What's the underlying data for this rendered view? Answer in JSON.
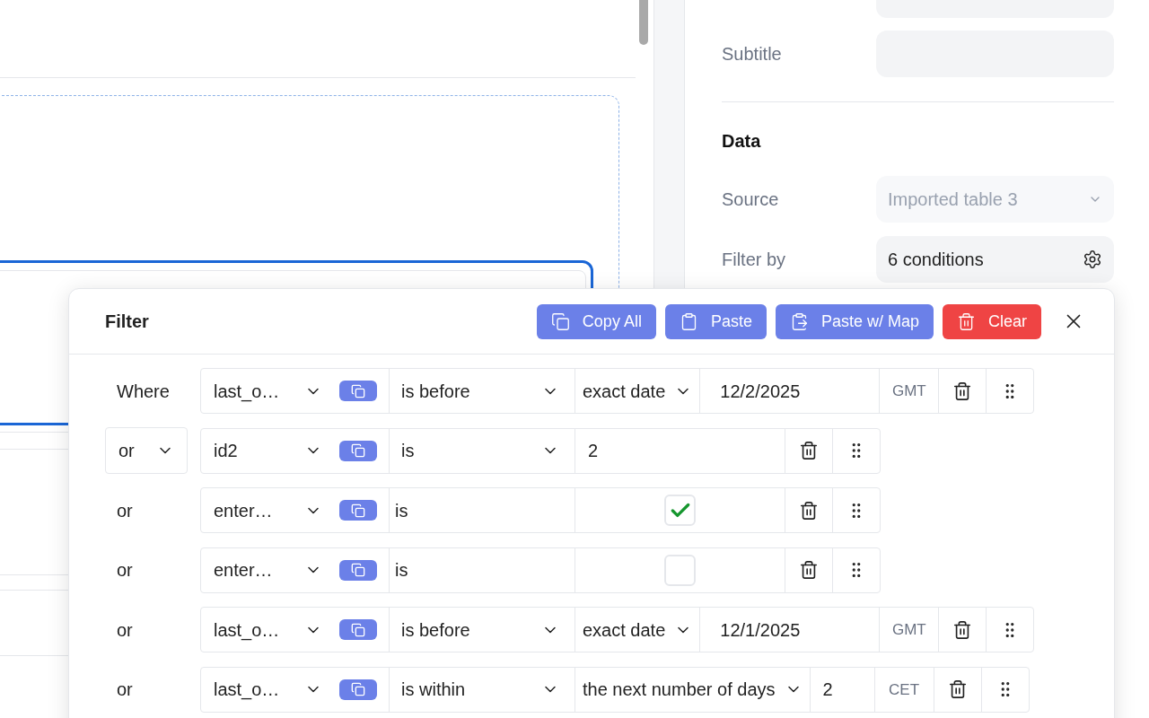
{
  "panel": {
    "subtitle": {
      "label": "Subtitle"
    },
    "section_title": "Data",
    "source": {
      "label": "Source",
      "value": "Imported table 3",
      "disabled": true
    },
    "filter_by": {
      "label": "Filter by",
      "value": "6 conditions"
    }
  },
  "filter": {
    "title": "Filter",
    "actions": [
      {
        "label": "Copy All",
        "kind": "copy"
      },
      {
        "label": "Paste",
        "kind": "paste"
      },
      {
        "label": "Paste w/ Map",
        "kind": "paste-map"
      },
      {
        "label": "Clear",
        "kind": "clear"
      }
    ],
    "rows": [
      {
        "connector": {
          "text": "Where",
          "kind": "label"
        },
        "field": "last_o…",
        "operator": {
          "text": "is before",
          "dropdown": true
        },
        "cells": [
          {
            "kind": "select",
            "text": "exact date"
          },
          {
            "kind": "date-input",
            "text": "12/2/2025"
          },
          {
            "kind": "timezone",
            "text": "GMT"
          }
        ]
      },
      {
        "connector": {
          "text": "or",
          "kind": "select"
        },
        "field": "id2",
        "operator": {
          "text": "is",
          "dropdown": true
        },
        "cells": [
          {
            "kind": "wide-input",
            "text": "2"
          }
        ]
      },
      {
        "connector": {
          "text": "or",
          "kind": "label"
        },
        "field": "enter…",
        "operator": {
          "text": "is",
          "dropdown": false
        },
        "cells": [
          {
            "kind": "checkbox",
            "checked": true
          }
        ]
      },
      {
        "connector": {
          "text": "or",
          "kind": "label"
        },
        "field": "enter…",
        "operator": {
          "text": "is",
          "dropdown": false
        },
        "cells": [
          {
            "kind": "checkbox",
            "checked": false
          }
        ]
      },
      {
        "connector": {
          "text": "or",
          "kind": "label"
        },
        "field": "last_o…",
        "operator": {
          "text": "is before",
          "dropdown": true
        },
        "cells": [
          {
            "kind": "select",
            "text": "exact date"
          },
          {
            "kind": "date-input",
            "text": "12/1/2025"
          },
          {
            "kind": "timezone",
            "text": "GMT"
          }
        ]
      },
      {
        "connector": {
          "text": "or",
          "kind": "label"
        },
        "field": "last_o…",
        "operator": {
          "text": "is within",
          "dropdown": true
        },
        "cells": [
          {
            "kind": "select",
            "text": "the next number of days"
          },
          {
            "kind": "short-input",
            "text": "2"
          },
          {
            "kind": "timezone",
            "text": "CET"
          }
        ]
      }
    ]
  }
}
